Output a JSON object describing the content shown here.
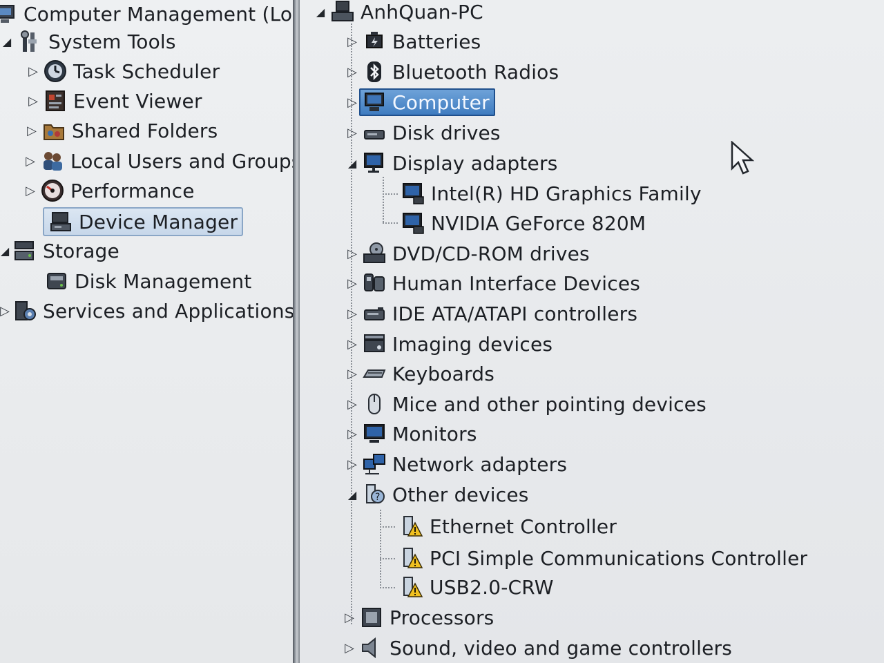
{
  "left_tree": {
    "root": "Computer Management (Local",
    "system_tools": "System Tools",
    "task_scheduler": "Task Scheduler",
    "event_viewer": "Event Viewer",
    "shared_folders": "Shared Folders",
    "local_users": "Local Users and Groups",
    "performance": "Performance",
    "device_manager": "Device Manager",
    "storage": "Storage",
    "disk_management": "Disk Management",
    "services_apps": "Services and Applications"
  },
  "device_tree": {
    "root": "AnhQuan-PC",
    "batteries": "Batteries",
    "bluetooth": "Bluetooth Radios",
    "computer": "Computer",
    "disk_drives": "Disk drives",
    "display_adapters": "Display adapters",
    "display_children": [
      "Intel(R) HD Graphics Family",
      "NVIDIA GeForce 820M"
    ],
    "dvd": "DVD/CD-ROM drives",
    "hid": "Human Interface Devices",
    "ide": "IDE ATA/ATAPI controllers",
    "imaging": "Imaging devices",
    "keyboards": "Keyboards",
    "mice": "Mice and other pointing devices",
    "monitors": "Monitors",
    "network": "Network adapters",
    "other": "Other devices",
    "other_children": [
      "Ethernet Controller",
      "PCI Simple Communications Controller",
      "USB2.0-CRW"
    ],
    "processors": "Processors",
    "sound": "Sound, video and game controllers"
  },
  "icons": {
    "computer-management": "computer-management-icon",
    "toolbox": "toolbox-icon",
    "clock": "clock-icon",
    "event-log": "event-log-icon",
    "shared-folder": "shared-folder-icon",
    "users": "users-icon",
    "gauge": "gauge-icon",
    "device-manager": "device-manager-icon",
    "storage": "storage-icon",
    "disk": "disk-icon",
    "services": "services-icon",
    "warning": "warning-device-icon"
  },
  "colors": {
    "selection": "#3f7cc0",
    "warning": "#f0c020"
  }
}
